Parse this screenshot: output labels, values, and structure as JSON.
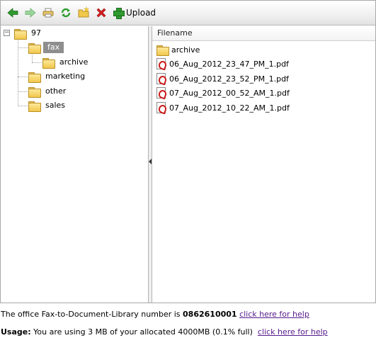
{
  "toolbar": {
    "buttons": [
      {
        "name": "back-arrow-icon",
        "color": "#2e9b2e"
      },
      {
        "name": "forward-arrow-icon",
        "color": "#9bd49b"
      },
      {
        "name": "print-icon",
        "color": "#d8b45a"
      },
      {
        "name": "refresh-icon",
        "color": "#2e9b2e"
      },
      {
        "name": "new-folder-icon",
        "color": "#f2c84b"
      },
      {
        "name": "delete-icon",
        "color": "#d62020"
      }
    ],
    "upload_label": "Upload"
  },
  "tree": {
    "root": {
      "label": "97"
    },
    "items": [
      {
        "label": "fax",
        "selected": true
      },
      {
        "label": "archive"
      },
      {
        "label": "marketing"
      },
      {
        "label": "other"
      },
      {
        "label": "sales"
      }
    ]
  },
  "file_list": {
    "header": "Filename",
    "rows": [
      {
        "type": "folder",
        "name": "archive"
      },
      {
        "type": "pdf",
        "name": "06_Aug_2012_23_47_PM_1.pdf"
      },
      {
        "type": "pdf",
        "name": "06_Aug_2012_23_52_PM_1.pdf"
      },
      {
        "type": "pdf",
        "name": "07_Aug_2012_00_52_AM_1.pdf"
      },
      {
        "type": "pdf",
        "name": "07_Aug_2012_10_22_AM_1.pdf"
      }
    ]
  },
  "footer": {
    "fax_prefix": "The office Fax-to-Document-Library number is ",
    "fax_number": "0862610001",
    "fax_help": "click here for help",
    "usage_label": "Usage:",
    "usage_text": " You are using 3 MB of your allocated 4000MB (0.1% full)",
    "usage_help": "click here for help"
  },
  "colors": {
    "selection": "#8e8e8e",
    "link": "#551a8b",
    "folder": "#f2c84b"
  }
}
